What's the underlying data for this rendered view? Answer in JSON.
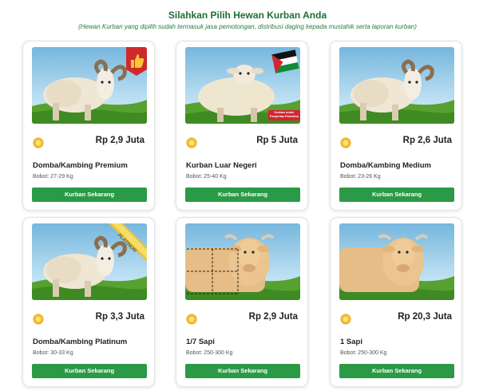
{
  "header": {
    "title": "Silahkan Pilih Hewan Kurban Anda",
    "subtitle": "(Hewan Kurban yang dipilih sudah termasuk jasa pemotongan, distribusi daging kepada mustahik serta laporan kurban)"
  },
  "products": [
    {
      "name": "Domba/Kambing Premium",
      "price": "Rp 2,9 Juta",
      "weight": "Bobot: 27-29 Kg",
      "button": "Kurban Sekarang",
      "badge": "thumbs-up"
    },
    {
      "name": "Kurban Luar Negeri",
      "price": "Rp 5 Juta",
      "weight": "Bobot: 25-40 Kg",
      "button": "Kurban Sekarang",
      "badge": "palestine-flag",
      "banner": "Kurban untuk Penyintas Palestina"
    },
    {
      "name": "Domba/Kambing Medium",
      "price": "Rp 2,6 Juta",
      "weight": "Bobot: 23-26 Kg",
      "button": "Kurban Sekarang"
    },
    {
      "name": "Domba/Kambing Platinum",
      "price": "Rp 3,3 Juta",
      "weight": "Bobot: 30-33 Kg",
      "button": "Kurban Sekarang",
      "badge": "platinum-ribbon",
      "ribbon": "PLATINUM"
    },
    {
      "name": "1/7 Sapi",
      "price": "Rp 2,9 Juta",
      "weight": "Bobot: 250-300 Kg",
      "button": "Kurban Sekarang",
      "badge": "cut-lines"
    },
    {
      "name": "1 Sapi",
      "price": "Rp 20,3 Juta",
      "weight": "Bobot: 250-300 Kg",
      "button": "Kurban Sekarang"
    }
  ],
  "colors": {
    "accent": "#2a9a46",
    "title": "#1f6e35",
    "grass": "#4f9a2c",
    "coin": "#f4c430"
  },
  "icons": {
    "coin": "coin-icon",
    "thumbs": "thumbs-up-icon",
    "flag": "palestine-flag-icon"
  }
}
